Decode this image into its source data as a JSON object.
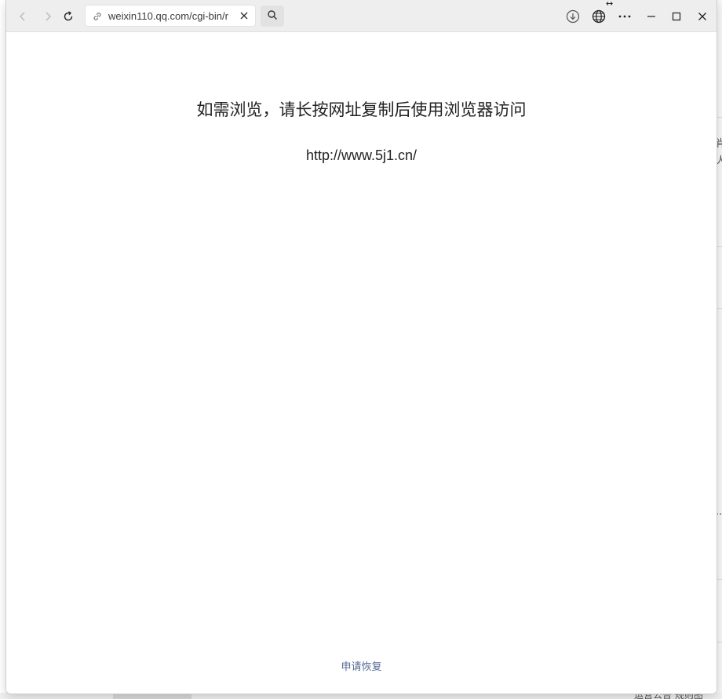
{
  "browser": {
    "address_url": "weixin110.qq.com/cgi-bin/r",
    "icons": {
      "back": "back-arrow-icon",
      "forward": "forward-arrow-icon",
      "reload": "reload-icon",
      "link": "link-icon",
      "clear": "close-icon",
      "search": "search-icon",
      "download": "download-icon",
      "translate": "globe-icon",
      "more": "more-icon",
      "minimize": "minimize-icon",
      "maximize": "maximize-icon",
      "close": "close-icon"
    }
  },
  "page": {
    "message": "如需浏览，请长按网址复制后使用浏览器访问",
    "url": "http://www.5j1.cn/",
    "footer_link": "申请恢复"
  },
  "background": {
    "fragment_1": "肖",
    "fragment_2": "人",
    "fragment_3": "...",
    "fragment_4": "运营公告  规则图"
  },
  "colors": {
    "link": "#576b95",
    "text": "#222222",
    "titlebar": "#eeeeee"
  }
}
